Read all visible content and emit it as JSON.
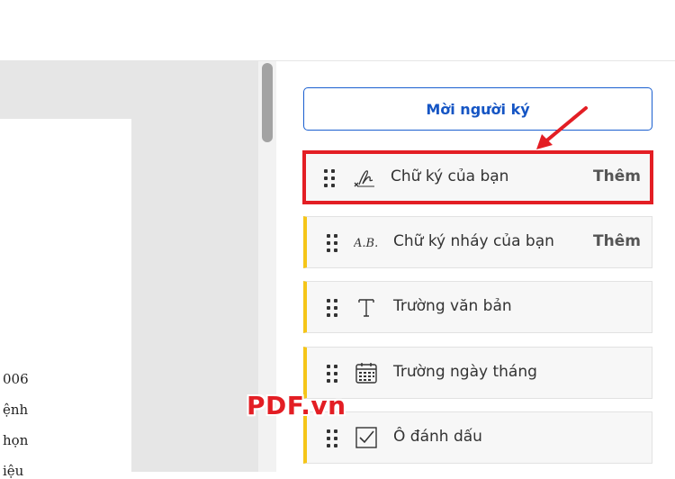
{
  "document": {
    "lines": [
      "006",
      "ệnh",
      "họn",
      "iệu"
    ]
  },
  "panel": {
    "invite_label": "Mời người ký",
    "fields": [
      {
        "label": "Chữ ký của bạn",
        "action": "Thêm",
        "icon": "signature-icon"
      },
      {
        "label": "Chữ ký nháy của bạn",
        "action": "Thêm",
        "icon": "initials-icon"
      },
      {
        "label": "Trường văn bản",
        "icon": "text-field-icon"
      },
      {
        "label": "Trường ngày tháng",
        "icon": "calendar-icon"
      },
      {
        "label": "Ô đánh dấu",
        "icon": "checkbox-icon"
      }
    ]
  },
  "overlay": {
    "watermark": "PDF.vn",
    "highlight_color": "#e31e24",
    "accent_color": "#f5c518",
    "invite_color": "#1555c4"
  }
}
